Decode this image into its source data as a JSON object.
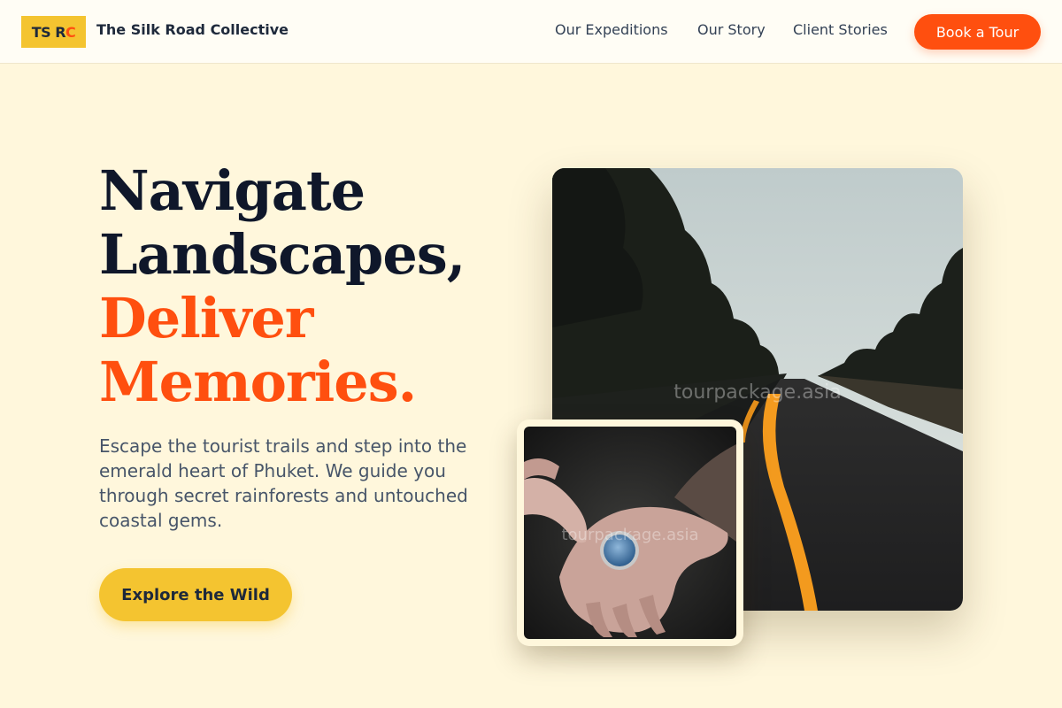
{
  "header": {
    "logo_part1": "TS R",
    "logo_part2": "C",
    "brand_name": "The Silk Road Collective",
    "nav": [
      "Our Expeditions",
      "Our Story",
      "Client Stories"
    ],
    "book_button": "Book a Tour"
  },
  "hero": {
    "headline_line1": "Navigate",
    "headline_line2": "Landscapes,",
    "headline_line3": "Deliver",
    "headline_line4": "Memories.",
    "description": "Escape the tourist trails and step into the emerald heart of Phuket. We guide you through secret rainforests and untouched coastal gems.",
    "cta_button": "Explore the Wild"
  },
  "images": {
    "main_watermark": "tourpackage.asia",
    "small_watermark": "tourpackage.asia"
  },
  "colors": {
    "background": "#FFF7DC",
    "accent_orange": "#FF4F0F",
    "accent_yellow": "#F4C430",
    "dark_text": "#0F172A"
  }
}
